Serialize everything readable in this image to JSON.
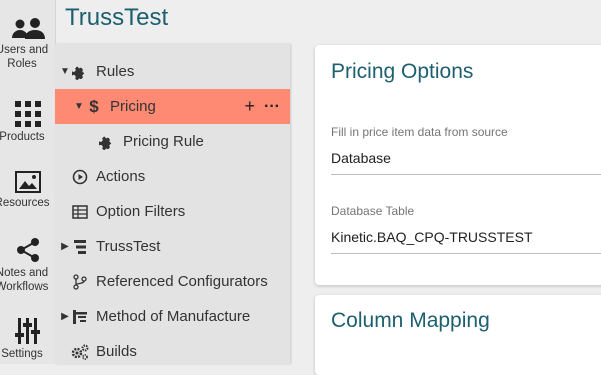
{
  "app": {
    "title": "TrussTest"
  },
  "rail": [
    {
      "label_line1": "Users and",
      "label_line2": "Roles",
      "icon": "users-icon"
    },
    {
      "label_line1": "Products",
      "label_line2": "",
      "icon": "grid-icon"
    },
    {
      "label_line1": "Resources",
      "label_line2": "",
      "icon": "image-icon"
    },
    {
      "label_line1": "Notes and",
      "label_line2": "Workflows",
      "icon": "share-icon"
    },
    {
      "label_line1": "Settings",
      "label_line2": "",
      "icon": "sliders-icon"
    }
  ],
  "tree": {
    "items": [
      {
        "label": "Rules",
        "icon": "puzzle-icon",
        "toggle": "▼"
      },
      {
        "label": "Pricing",
        "icon": "dollar-icon",
        "toggle": "▼"
      },
      {
        "label": "Pricing Rule",
        "icon": "puzzle-icon",
        "toggle": ""
      },
      {
        "label": "Actions",
        "icon": "play-circle-icon",
        "toggle": ""
      },
      {
        "label": "Option Filters",
        "icon": "table-icon",
        "toggle": ""
      },
      {
        "label": "TrussTest",
        "icon": "hierarchy-icon",
        "toggle": "▶"
      },
      {
        "label": "Referenced Configurators",
        "icon": "branch-icon",
        "toggle": ""
      },
      {
        "label": "Method of Manufacture",
        "icon": "mom-icon",
        "toggle": "▶"
      },
      {
        "label": "Builds",
        "icon": "gears-icon",
        "toggle": ""
      }
    ],
    "selected_actions": {
      "add": "+",
      "more": "···"
    }
  },
  "pricing_options": {
    "title": "Pricing Options",
    "fill_label": "Fill in price item data from source",
    "fill_value": "Database",
    "table_label": "Database Table",
    "table_value": "Kinetic.BAQ_CPQ-TRUSSTEST"
  },
  "column_mapping": {
    "title": "Column Mapping"
  },
  "colors": {
    "accent": "#1d5f6f",
    "selected": "#ff8a73"
  }
}
